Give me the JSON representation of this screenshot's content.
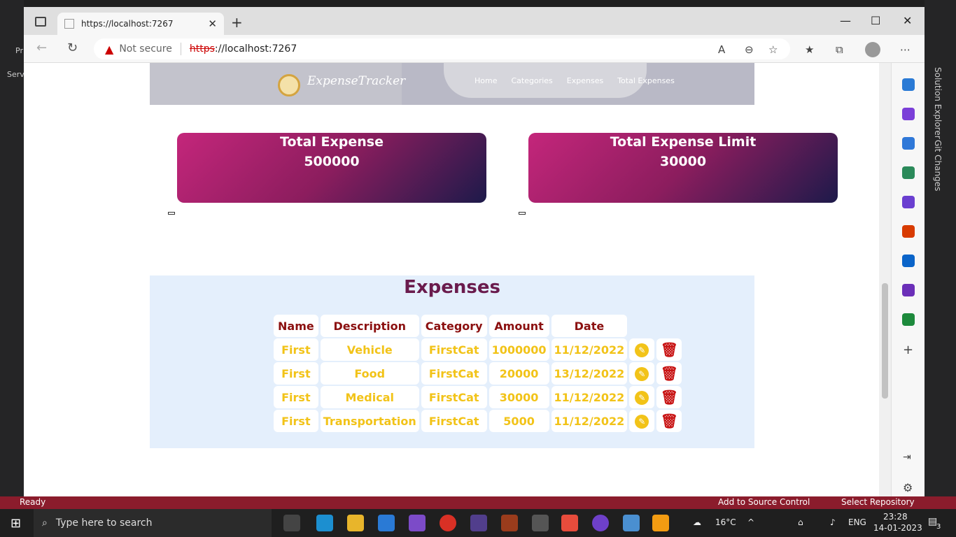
{
  "vs": {
    "left_labels": [
      "Serv",
      "Pr"
    ],
    "right_labels": [
      "Solution Explorer",
      "Git Changes"
    ]
  },
  "browser": {
    "tab_title": "https://localhost:7267",
    "address": {
      "warning": "Not secure",
      "scheme": "https",
      "rest": "://localhost:7267"
    }
  },
  "header": {
    "logo_text": "ExpenseTracker",
    "nav": [
      "Home",
      "Categories",
      "Expenses",
      "Total Expenses"
    ]
  },
  "cards": [
    {
      "title": "Total Expense",
      "value": "500000"
    },
    {
      "title": "Total Expense Limit",
      "value": "30000"
    }
  ],
  "expenses": {
    "title": "Expenses",
    "columns": [
      "Name",
      "Description",
      "Category",
      "Amount",
      "Date"
    ],
    "rows": [
      {
        "name": "First",
        "description": "Vehicle",
        "category": "FirstCat",
        "amount": "1000000",
        "date": "11/12/2022"
      },
      {
        "name": "First",
        "description": "Food",
        "category": "FirstCat",
        "amount": "20000",
        "date": "13/12/2022"
      },
      {
        "name": "First",
        "description": "Medical",
        "category": "FirstCat",
        "amount": "30000",
        "date": "11/12/2022"
      },
      {
        "name": "First",
        "description": "Transportation",
        "category": "FirstCat",
        "amount": "5000",
        "date": "11/12/2022"
      }
    ]
  },
  "statusbar": {
    "ready": "Ready",
    "source_control": "Add to Source Control",
    "repo": "Select Repository"
  },
  "taskbar": {
    "search_placeholder": "Type here to search",
    "weather": "16°C",
    "lang": "ENG",
    "time": "23:28",
    "date": "14-01-2023",
    "notifications": "3"
  }
}
